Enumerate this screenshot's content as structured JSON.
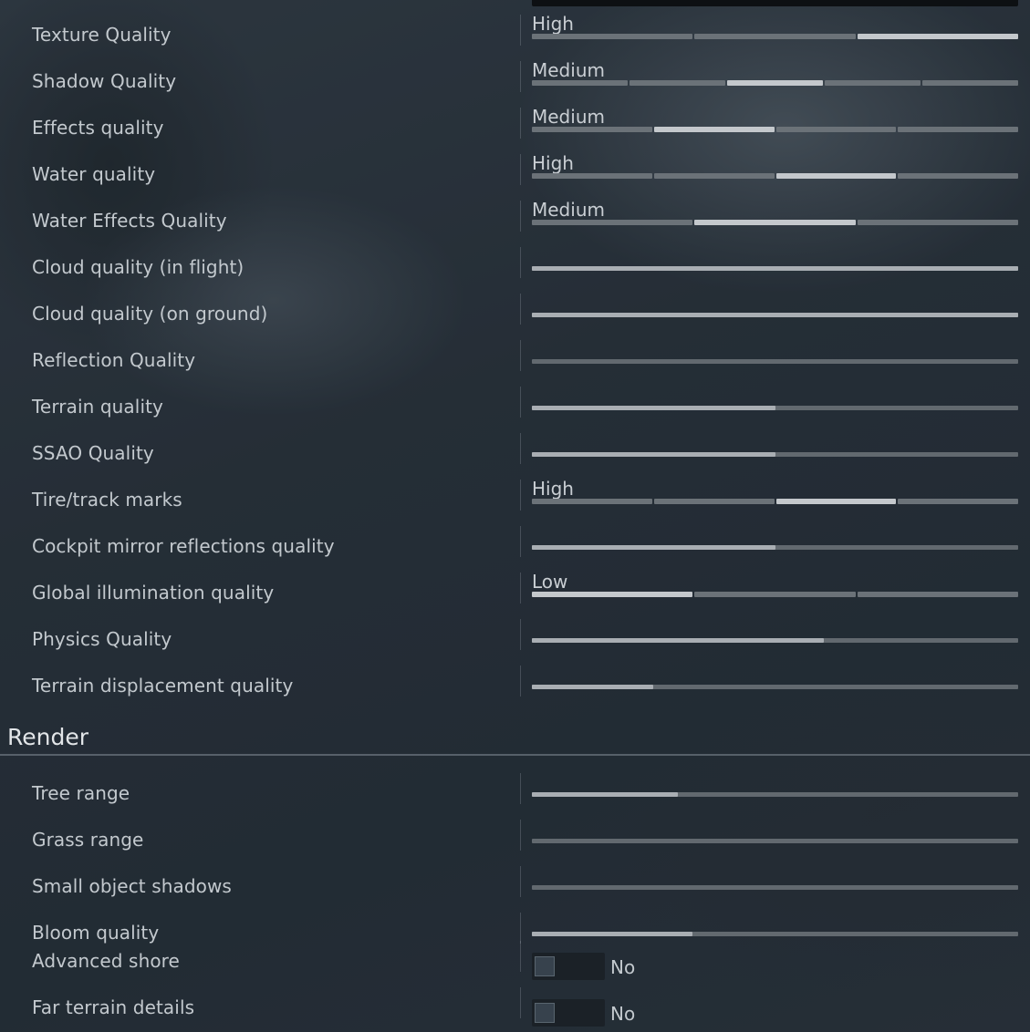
{
  "settings": {
    "rows": [
      {
        "label": "Texture Quality",
        "value": "High",
        "segments": 3,
        "selected": 2
      },
      {
        "label": "Shadow Quality",
        "value": "Medium",
        "segments": 5,
        "selected": 2
      },
      {
        "label": "Effects quality",
        "value": "Medium",
        "segments": 4,
        "selected": 1
      },
      {
        "label": "Water quality",
        "value": "High",
        "segments": 4,
        "selected": 2
      },
      {
        "label": "Water Effects Quality",
        "value": "Medium",
        "segments": 3,
        "selected": 1
      },
      {
        "label": "Cloud quality (in flight)",
        "value": "",
        "fill": 1.0
      },
      {
        "label": "Cloud quality (on ground)",
        "value": "",
        "fill": 1.0
      },
      {
        "label": "Reflection Quality",
        "value": "",
        "fill": 0.0
      },
      {
        "label": "Terrain quality",
        "value": "",
        "fill": 0.5
      },
      {
        "label": "SSAO Quality",
        "value": "",
        "fill": 0.5
      },
      {
        "label": "Tire/track marks",
        "value": "High",
        "segments": 4,
        "selected": 2
      },
      {
        "label": "Cockpit mirror reflections quality",
        "value": "",
        "fill": 0.5
      },
      {
        "label": "Global illumination quality",
        "value": "Low",
        "segments": 3,
        "selected": 0
      },
      {
        "label": "Physics Quality",
        "value": "",
        "fill": 0.6
      },
      {
        "label": "Terrain displacement quality",
        "value": "",
        "fill": 0.25
      }
    ]
  },
  "render": {
    "title": "Render",
    "rows": [
      {
        "label": "Tree range",
        "fill": 0.3
      },
      {
        "label": "Grass range",
        "fill": 0.0
      },
      {
        "label": "Small object shadows",
        "fill": 0.0
      },
      {
        "label": "Bloom quality",
        "fill": 0.33
      }
    ],
    "toggles": [
      {
        "label": "Advanced shore",
        "state": "No"
      },
      {
        "label": "Far terrain details",
        "state": "No"
      }
    ]
  }
}
